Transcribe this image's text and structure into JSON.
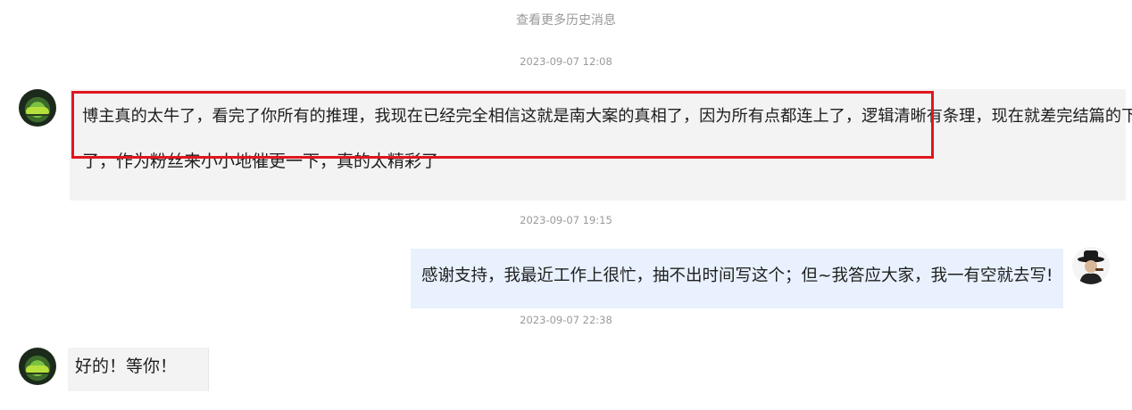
{
  "chat": {
    "load_more": "查看更多历史消息",
    "messages": [
      {
        "sender": "fan",
        "timestamp": "2023-09-07 12:08",
        "line1": "博主真的太牛了，看完了你所有的推理，我现在已经完全相信这就是南大案的真相了，因为所有点都连上了，逻辑清晰有条理，现在就差完结篇的下半部分",
        "line2": "了，作为粉丝来小小地催更一下，真的太精彩了"
      },
      {
        "sender": "author",
        "timestamp": "2023-09-07 19:15",
        "text": "感谢支持，我最近工作上很忙，抽不出时间写这个；但~我答应大家，我一有空就去写!"
      },
      {
        "sender": "fan",
        "timestamp": "2023-09-07 22:38",
        "text": "好的！等你！"
      }
    ]
  },
  "colors": {
    "highlight": "#e0161f",
    "left_bubble": "#f3f3f3",
    "right_bubble": "#e8f1fd",
    "muted_text": "#999999"
  },
  "icons": {
    "fan_avatar": "green-car-avatar",
    "author_avatar": "detective-hat-avatar"
  }
}
